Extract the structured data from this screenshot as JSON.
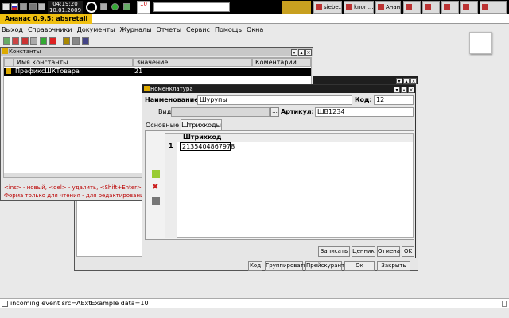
{
  "taskbar": {
    "clock_time": "04:19:20",
    "clock_date": "10.01.2009",
    "calendar_day": "10",
    "tasks": [
      {
        "label": "siebe..."
      },
      {
        "label": "knorr..."
      },
      {
        "label": "Анан..."
      }
    ]
  },
  "app": {
    "title": "Ананас 0.9.5: absretail"
  },
  "menu": {
    "items": [
      {
        "label": "Выход"
      },
      {
        "label": "Справочники"
      },
      {
        "label": "Документы"
      },
      {
        "label": "Журналы"
      },
      {
        "label": "Отчеты"
      },
      {
        "label": "Сервис"
      },
      {
        "label": "Помощь"
      },
      {
        "label": "Окна"
      }
    ]
  },
  "constants_window": {
    "title": "Константы",
    "columns": [
      "Имя константы",
      "Значение",
      "Коментарий"
    ],
    "rows": [
      {
        "name": "ПрефиксШКТовара",
        "value": "21",
        "comment": ""
      }
    ],
    "hint1": "<ins> - новый, <del> - удалить, <Shift+Enter>",
    "hint2": "Форма только для чтения - для редактирования"
  },
  "back_window": {
    "buttons": [
      "Код",
      "Группировать",
      "Прейскурант",
      "Ок",
      "Закрыть"
    ]
  },
  "nomenclature": {
    "title": "Номенклатура",
    "name_label": "Наименование:",
    "name_value": "Шурупы",
    "code_label": "Код:",
    "code_value": "12",
    "kind_label": "Вид:",
    "kind_value": "",
    "browse_label": "...",
    "article_label": "Артикул:",
    "article_value": "ШВ1234",
    "tabs": [
      "Основные",
      "Штрихкоды"
    ],
    "barcode_header": "Штрихкод",
    "barcode_rows": [
      {
        "num": "1",
        "code": "2135404867978"
      }
    ],
    "buttons": [
      "Записать",
      "Ценник",
      "Отмена",
      "OK"
    ]
  },
  "statusbar": {
    "text": "incoming event src=AExtExample data=10"
  }
}
